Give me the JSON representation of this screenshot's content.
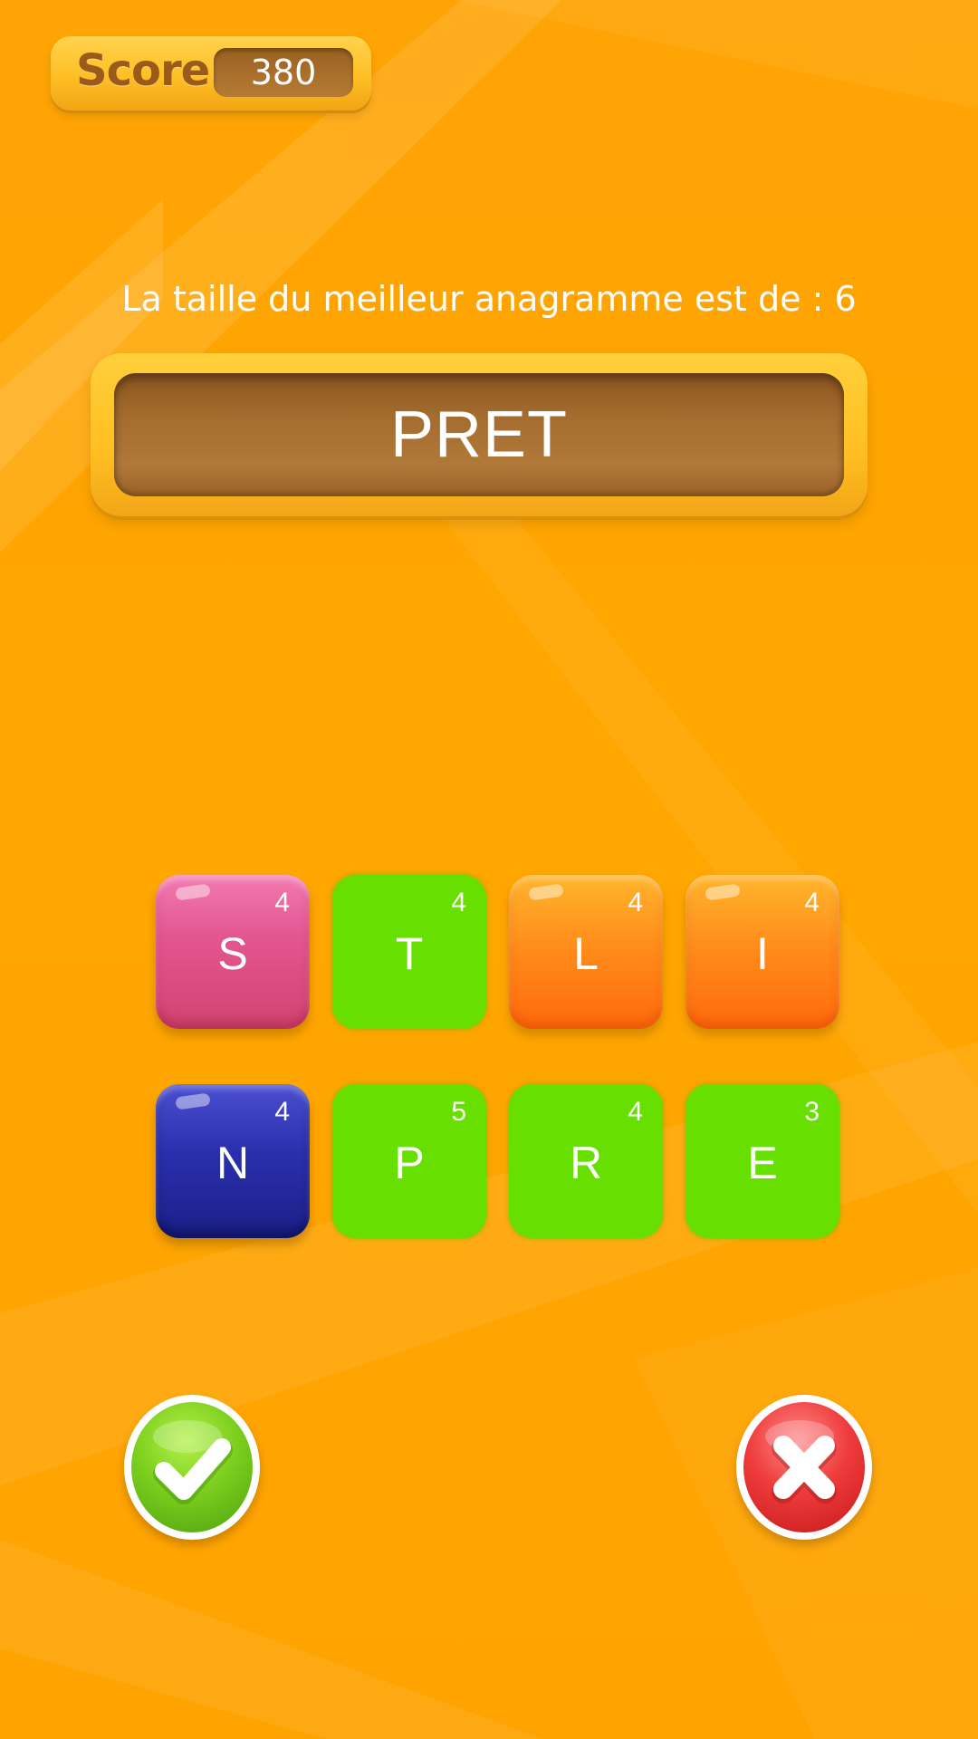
{
  "header": {
    "score_label": "Score",
    "score_value": "380"
  },
  "hint": "La taille du meilleur anagramme est de : 6",
  "current_word": "PRET",
  "tiles": [
    {
      "letter": "S",
      "points": "4",
      "color": "pink",
      "selected": false
    },
    {
      "letter": "T",
      "points": "4",
      "color": "green",
      "selected": true
    },
    {
      "letter": "L",
      "points": "4",
      "color": "orange",
      "selected": false
    },
    {
      "letter": "I",
      "points": "4",
      "color": "orange",
      "selected": false
    },
    {
      "letter": "N",
      "points": "4",
      "color": "blue",
      "selected": false
    },
    {
      "letter": "P",
      "points": "5",
      "color": "green",
      "selected": true
    },
    {
      "letter": "R",
      "points": "4",
      "color": "green",
      "selected": true
    },
    {
      "letter": "E",
      "points": "3",
      "color": "green",
      "selected": true
    }
  ],
  "buttons": {
    "validate_icon": "check-icon",
    "cancel_icon": "close-icon"
  },
  "colors": {
    "background": "#ffa300",
    "selected_tile": "#67df00",
    "word_board": "#a46c2e"
  }
}
